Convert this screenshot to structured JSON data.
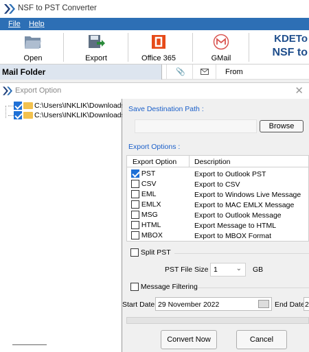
{
  "app": {
    "title": "NSF to PST Converter"
  },
  "menu": {
    "file": "File",
    "help": "Help"
  },
  "toolbar": {
    "open": "Open",
    "export": "Export",
    "office365": "Office 365",
    "gmail": "GMail",
    "brand_line1": "KDETo",
    "brand_line2": "NSF to"
  },
  "left_panel": {
    "title": "Mail Folder"
  },
  "list_header": {
    "from": "From"
  },
  "dialog": {
    "title": "Export Option",
    "tree": [
      {
        "path": "C:\\Users\\INKLIK\\Downloads"
      },
      {
        "path": "C:\\Users\\INKLIK\\Downloads"
      }
    ],
    "save_path_label": "Save Destination Path :",
    "save_path_value": "",
    "browse": "Browse",
    "export_options_label": "Export Options :",
    "columns": [
      "Export Option",
      "Description"
    ],
    "options": [
      {
        "name": "PST",
        "desc": "Export to Outlook PST",
        "checked": true
      },
      {
        "name": "CSV",
        "desc": "Export to CSV",
        "checked": false
      },
      {
        "name": "EML",
        "desc": "Export to Windows Live Message",
        "checked": false
      },
      {
        "name": "EMLX",
        "desc": "Export to MAC EMLX Message",
        "checked": false
      },
      {
        "name": "MSG",
        "desc": "Export to Outlook Message",
        "checked": false
      },
      {
        "name": "HTML",
        "desc": "Export Message to HTML",
        "checked": false
      },
      {
        "name": "MBOX",
        "desc": "Export to MBOX Format",
        "checked": false
      }
    ],
    "split_pst": "Split PST",
    "pst_file_size_label": "PST File Size :",
    "pst_file_size_value": "1",
    "gb": "GB",
    "message_filtering": "Message Filtering",
    "start_date_label": "Start Date",
    "start_date_value": "29 November 2022",
    "end_date_label": "End Date",
    "end_date_value": "2",
    "convert": "Convert Now",
    "cancel": "Cancel"
  },
  "colors": {
    "accent": "#2d6fb5",
    "label_blue": "#1a5fc9",
    "checkbox": "#1e70d6"
  }
}
